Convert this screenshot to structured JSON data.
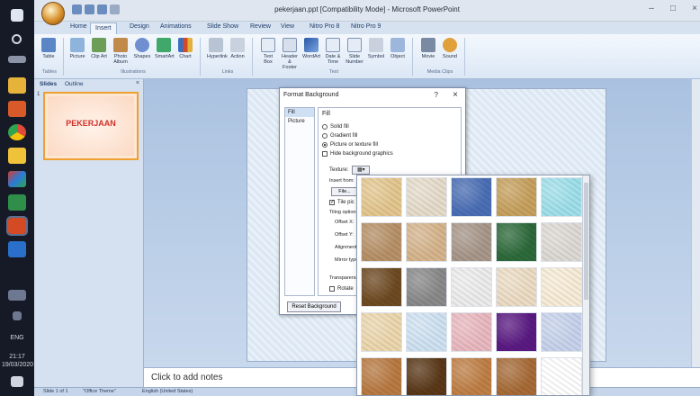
{
  "window": {
    "title": "pekerjaan.ppt [Compatibility Mode] - Microsoft PowerPoint",
    "minimize": "–",
    "maximize": "□",
    "close": "×"
  },
  "ribbon": {
    "tabs": [
      "Home",
      "Insert",
      "Design",
      "Animations",
      "Slide Show",
      "Review",
      "View",
      "Nitro Pro 8",
      "Nitro Pro 9"
    ],
    "active_tab": "Insert",
    "groups": [
      {
        "label": "Tables",
        "buttons": [
          "Table"
        ]
      },
      {
        "label": "Illustrations",
        "buttons": [
          "Picture",
          "Clip Art",
          "Photo Album",
          "Shapes",
          "SmartArt",
          "Chart"
        ]
      },
      {
        "label": "Links",
        "buttons": [
          "Hyperlink",
          "Action"
        ]
      },
      {
        "label": "Text",
        "buttons": [
          "Text Box",
          "Header & Footer",
          "WordArt",
          "Date & Time",
          "Slide Number",
          "Symbol",
          "Object"
        ]
      },
      {
        "label": "Media Clips",
        "buttons": [
          "Movie",
          "Sound"
        ]
      }
    ]
  },
  "side_panel": {
    "tabs": [
      "Slides",
      "Outline"
    ],
    "close": "×",
    "slide_number": "1",
    "slide_title": "PEKERJAAN"
  },
  "notes_placeholder": "Click to add notes",
  "status_bar": {
    "slide": "Slide 1 of 1",
    "theme": "\"Office Theme\"",
    "language": "English (United States)"
  },
  "taskbar": {
    "lang": "ENG",
    "time": "21:17",
    "date": "19/03/2020"
  },
  "dialog": {
    "title": "Format Background",
    "help": "?",
    "close": "×",
    "nav": [
      "Fill",
      "Picture"
    ],
    "fill_heading": "Fill",
    "options": [
      {
        "label": "Solid fill",
        "selected": false
      },
      {
        "label": "Gradient fill",
        "selected": false
      },
      {
        "label": "Picture or texture fill",
        "selected": true
      }
    ],
    "hide_graphics": "Hide background graphics",
    "texture_label": "Texture:",
    "insert_from": "Insert from:",
    "file_button": "File...",
    "tile_checkbox": "Tile pic",
    "tiling_options": "Tiling options",
    "offset_x": "Offset X:",
    "offset_y": "Offset Y:",
    "alignment": "Alignment:",
    "mirror_type": "Mirror type:",
    "transparency": "Transparency:",
    "rotate": "Rotate",
    "reset_button": "Reset Background"
  },
  "texture_swatches": [
    [
      "#e4c78f",
      "#e6dccb",
      "#4b6fb5",
      "#c7a15e",
      "#9fe0ea"
    ],
    [
      "#b79168",
      "#d6b58d",
      "#a8978a",
      "#2d6a3a",
      "#ddd9d4"
    ],
    [
      "#6e4a22",
      "#8a8a8a",
      "#ececec",
      "#ecdcc4",
      "#f7ecd7"
    ],
    [
      "#ecd7ae",
      "#cfe2f2",
      "#e9b9c0",
      "#5a1a82",
      "#c7d3ec"
    ],
    [
      "#b87a42",
      "#5a3818",
      "#bf7f46",
      "#a76b37",
      "#ffffff"
    ]
  ],
  "colors": {
    "accent": "#f0a030",
    "slide_title": "#d2302a",
    "ribbon_bg": "#dbe7f5",
    "taskbar": "#161a26"
  }
}
